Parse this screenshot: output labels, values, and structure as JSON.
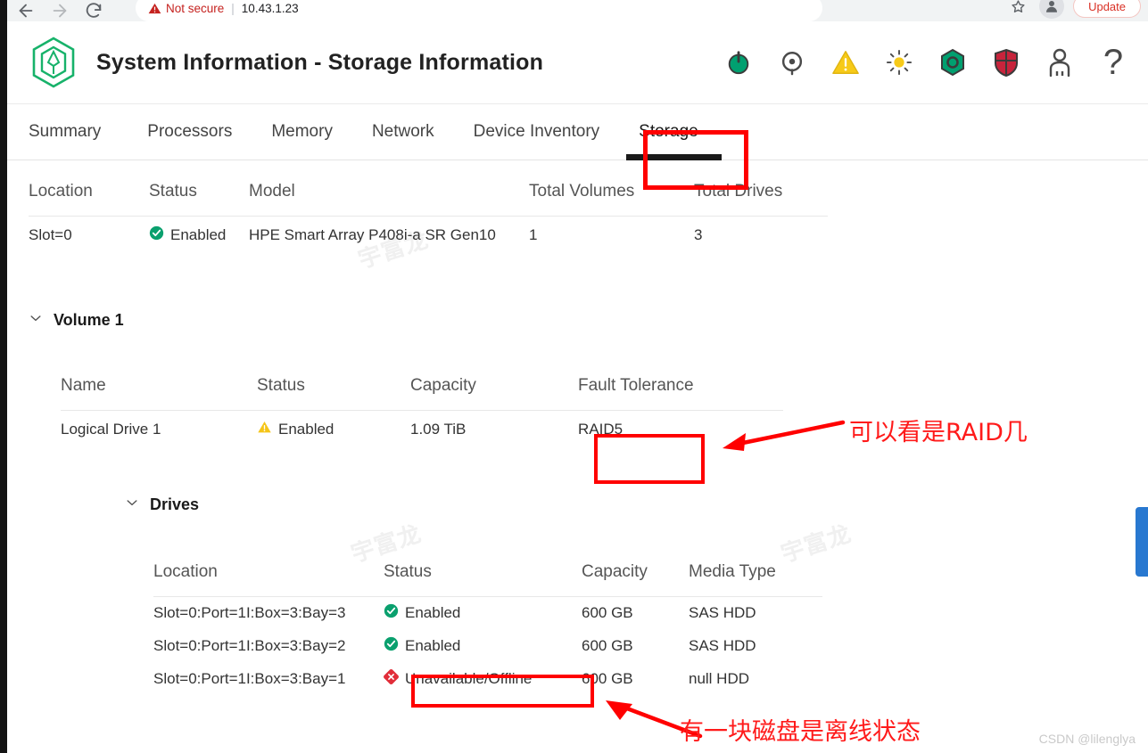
{
  "browser": {
    "security_label": "Not secure",
    "url": "10.43.1.23",
    "update_label": "Update",
    "back_icon": "back-arrow-icon",
    "forward_icon": "forward-arrow-icon",
    "reload_icon": "reload-icon",
    "star_icon": "bookmark-star-icon",
    "avatar_icon": "profile-avatar-icon"
  },
  "header": {
    "title": "System Information - Storage Information",
    "logo_icon": "hpe-ilo-hexagon-logo",
    "icons": [
      {
        "name": "power-icon",
        "label": "Power",
        "color": "#00a070"
      },
      {
        "name": "health-target-icon",
        "label": "Health",
        "color": "#4a4a4a"
      },
      {
        "name": "warning-triangle-icon",
        "label": "Warning",
        "color": "#f5c518"
      },
      {
        "name": "uid-light-icon",
        "label": "UID Light",
        "color": "#f5c518"
      },
      {
        "name": "hexagon-gear-icon",
        "label": "iLO Settings",
        "color": "#00a070"
      },
      {
        "name": "security-shield-icon",
        "label": "Security",
        "color": "#c8243c"
      },
      {
        "name": "user-account-icon",
        "label": "User",
        "color": "#4a4a4a"
      },
      {
        "name": "help-question-icon",
        "label": "Help",
        "color": "#4a4a4a"
      }
    ]
  },
  "tabs": [
    {
      "label": "Summary",
      "active": false
    },
    {
      "label": "Processors",
      "active": false
    },
    {
      "label": "Memory",
      "active": false
    },
    {
      "label": "Network",
      "active": false
    },
    {
      "label": "Device Inventory",
      "active": false
    },
    {
      "label": "Storage",
      "active": true
    }
  ],
  "controller_table": {
    "headers": [
      "Location",
      "Status",
      "Model",
      "Total Volumes",
      "Total Drives"
    ],
    "rows": [
      {
        "location": "Slot=0",
        "status": "Enabled",
        "status_icon": "status-ok-check-icon",
        "model": "HPE Smart Array P408i-a SR Gen10",
        "total_volumes": "1",
        "total_drives": "3"
      }
    ]
  },
  "volume": {
    "title": "Volume 1",
    "chevron_icon": "chevron-down-icon",
    "headers": [
      "Name",
      "Status",
      "Capacity",
      "Fault Tolerance"
    ],
    "rows": [
      {
        "name": "Logical Drive 1",
        "status": "Enabled",
        "status_icon": "status-warning-triangle-icon",
        "capacity": "1.09 TiB",
        "fault_tolerance": "RAID5"
      }
    ]
  },
  "drives": {
    "title": "Drives",
    "chevron_icon": "chevron-down-icon",
    "headers": [
      "Location",
      "Status",
      "Capacity",
      "Media Type"
    ],
    "rows": [
      {
        "location": "Slot=0:Port=1I:Box=3:Bay=3",
        "status": "Enabled",
        "status_icon": "status-ok-check-icon",
        "capacity": "600 GB",
        "media_type": "SAS HDD"
      },
      {
        "location": "Slot=0:Port=1I:Box=3:Bay=2",
        "status": "Enabled",
        "status_icon": "status-ok-check-icon",
        "capacity": "600 GB",
        "media_type": "SAS HDD"
      },
      {
        "location": "Slot=0:Port=1I:Box=3:Bay=1",
        "status": "Unavailable/Offline",
        "status_icon": "status-critical-diamond-icon",
        "capacity": "600 GB",
        "media_type": "null HDD"
      }
    ]
  },
  "annotations": {
    "color": "#ff0000",
    "raid_note": "可以看是RAID几",
    "offline_note": "有一块磁盘是离线状态"
  },
  "watermarks": {
    "tile_text": "宇富龙",
    "credit": "CSDN @lilenglya"
  }
}
